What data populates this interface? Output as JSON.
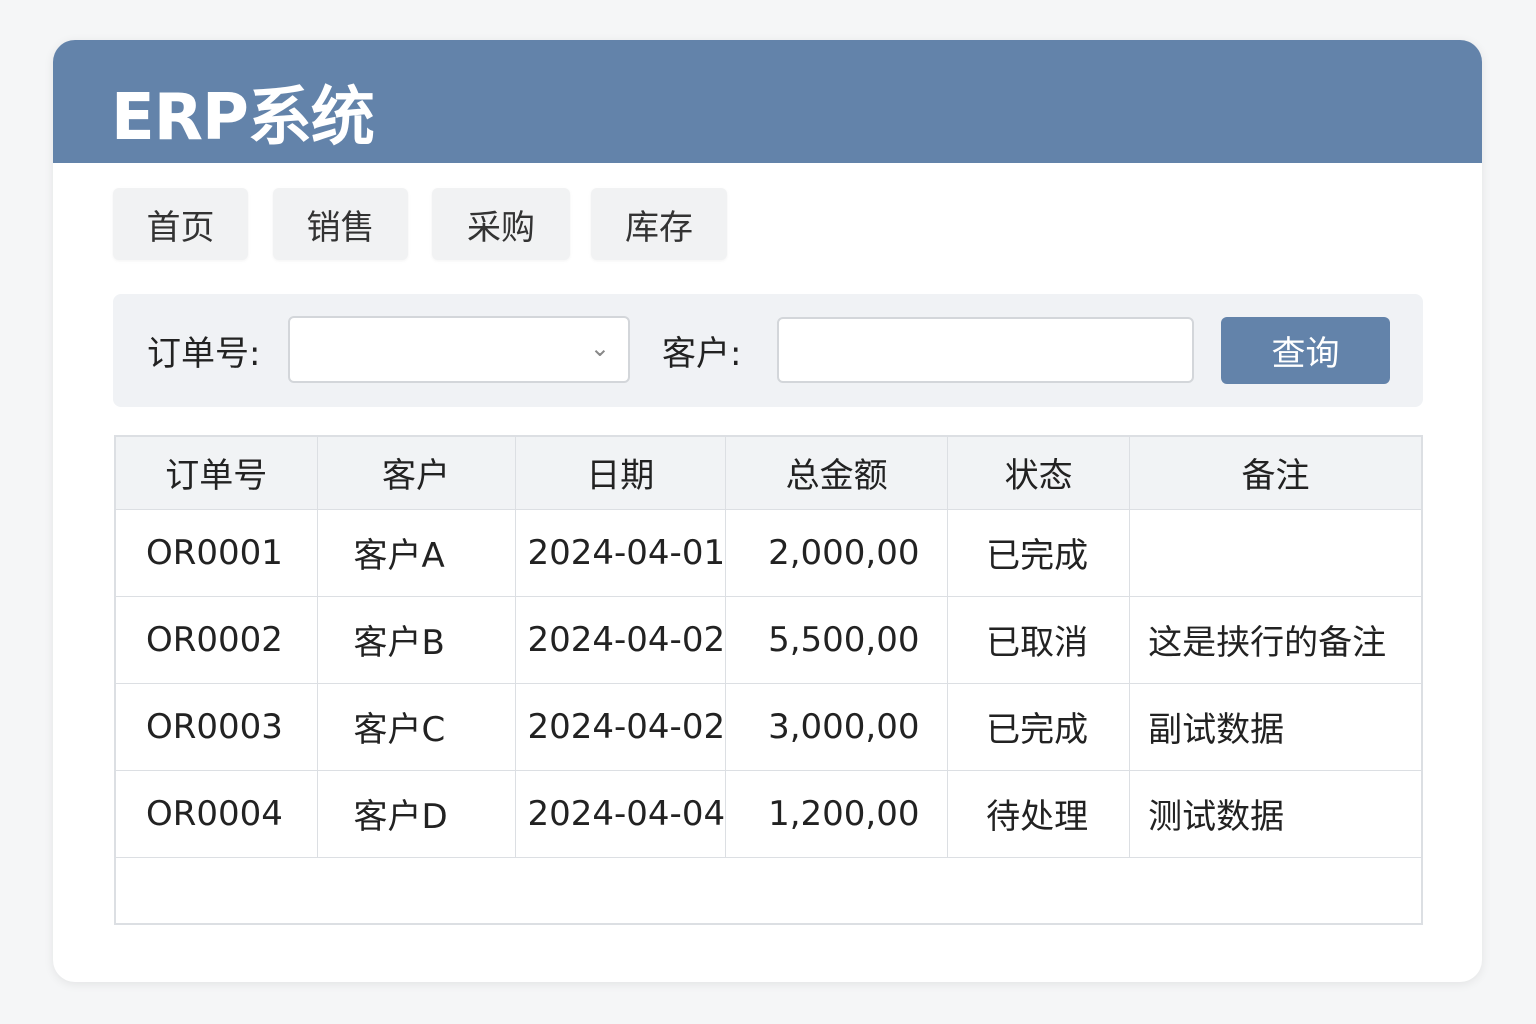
{
  "header": {
    "title": "ERP系统"
  },
  "nav": [
    "首页",
    "销售",
    "采购",
    "库存"
  ],
  "filter": {
    "order_label": "订单号:",
    "order_value": "",
    "customer_label": "客户:",
    "customer_value": "",
    "query_label": "查询"
  },
  "table": {
    "columns": [
      "订单号",
      "客户",
      "日期",
      "总金额",
      "状态",
      "备注"
    ],
    "rows": [
      [
        "OR0001",
        "客户A",
        "2024-04-01",
        "2,000,00",
        "已完成",
        ""
      ],
      [
        "OR0002",
        "客户B",
        "2024-04-02",
        "5,500,00",
        "已取消",
        "这是挟行的备注"
      ],
      [
        "OR0003",
        "客户C",
        "2024-04-02",
        "3,000,00",
        "已完成",
        "副试数据"
      ],
      [
        "OR0004",
        "客户D",
        "2024-04-04",
        "1,200,00",
        "待处理",
        "测试数据"
      ]
    ]
  },
  "colors": {
    "primary": "#6383aa"
  }
}
